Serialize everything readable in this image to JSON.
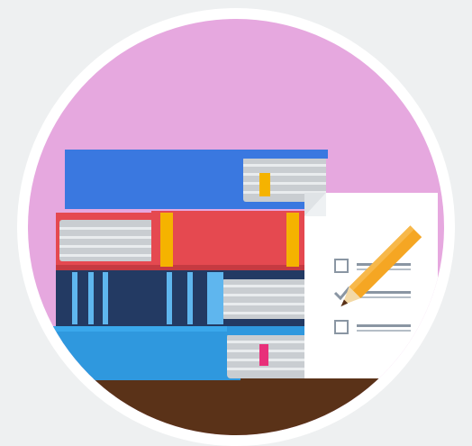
{
  "illustration": {
    "icon": "books-checklist-icon",
    "colors": {
      "page_background": "#eef0f1",
      "ring": "#ffffff",
      "circle_fill": "#e6a8df",
      "shelf": "#5a3218",
      "book_top_blue": "#3a78e0",
      "book_red": "#e54950",
      "book_navy": "#233a63",
      "book_bottom_blue": "#2f98de",
      "pages_gray": "#c9cdd1",
      "bookmark_yellow": "#f5b300",
      "bookmark_pink": "#e8307a",
      "paper": "#ffffff",
      "paper_fold": "#dfe3e6",
      "pencil_orange": "#f5a623",
      "checklist_lines": "#8a96a3"
    }
  }
}
